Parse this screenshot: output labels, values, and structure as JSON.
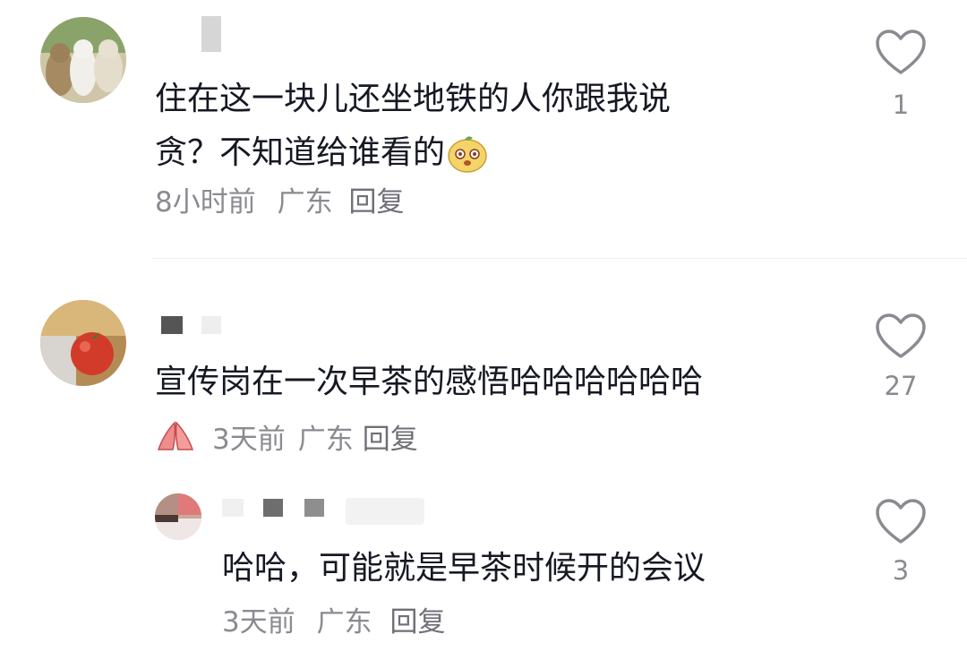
{
  "comments": [
    {
      "text_line1": "住在这一块儿还坐地铁的人你跟我说",
      "text_line2": "贪？不知道给谁看的",
      "emoji": "mango-emoji",
      "time": "8小时前",
      "location": "广东",
      "reply": "回复",
      "likes": "1"
    },
    {
      "text": "宣传岗在一次早茶的感悟哈哈哈哈哈哈",
      "badge": "pray-hands-emoji",
      "time": "3天前",
      "location": "广东",
      "reply": "回复",
      "likes": "27",
      "replies": [
        {
          "text": "哈哈，可能就是早茶时候开的会议",
          "time": "3天前",
          "location": "广东",
          "reply": "回复",
          "likes": "3"
        }
      ]
    }
  ],
  "colors": {
    "text": "#161823",
    "meta": "#8a8b91",
    "heart": "#8a8b91"
  }
}
